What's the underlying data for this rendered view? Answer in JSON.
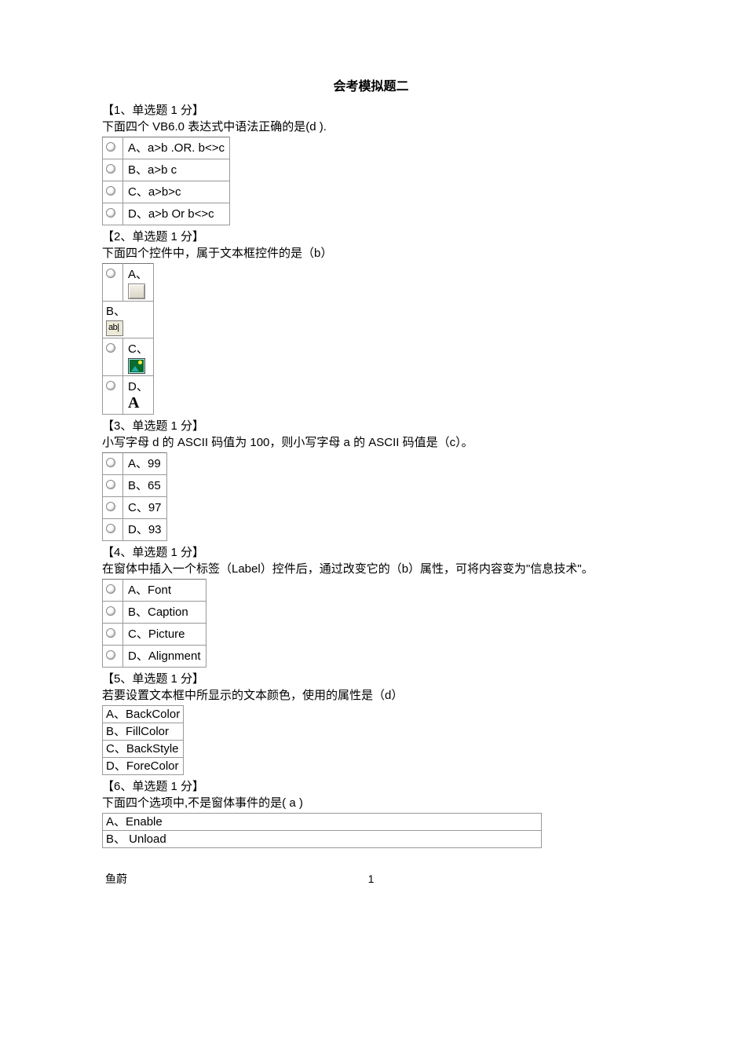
{
  "title": "会考模拟题二",
  "questions": [
    {
      "header": "【1、单选题 1 分】",
      "text": "下面四个 VB6.0 表达式中语法正确的是(d ).",
      "options": [
        {
          "label": "A、a>b .OR. b<>c",
          "radio": true
        },
        {
          "label": "B、a>b c",
          "radio": true
        },
        {
          "label": "C、a>b>c",
          "radio": true
        },
        {
          "label": "D、a>b Or b<>c",
          "radio": true
        }
      ]
    },
    {
      "header": "【2、单选题 1 分】",
      "text": "下面四个控件中，属于文本框控件的是（b）",
      "options": [
        {
          "label": "A、",
          "radio": true,
          "icon": "button"
        },
        {
          "label": "B、",
          "radio": false,
          "icon": "textbox",
          "noradio": true
        },
        {
          "label": "C、",
          "radio": true,
          "icon": "picturebox"
        },
        {
          "label": "D、",
          "radio": true,
          "icon": "label"
        }
      ]
    },
    {
      "header": "【3、单选题 1 分】",
      "text": "小写字母 d 的 ASCII 码值为 100，则小写字母 a 的 ASCII 码值是（c）。",
      "options": [
        {
          "label": "A、99",
          "radio": true
        },
        {
          "label": "B、65",
          "radio": true
        },
        {
          "label": "C、97",
          "radio": true
        },
        {
          "label": "D、93",
          "radio": true
        }
      ]
    },
    {
      "header": "【4、单选题 1 分】",
      "text": "在窗体中插入一个标签（Label）控件后，通过改变它的（b）属性，可将内容变为\"信息技术\"。",
      "options": [
        {
          "label": "A、Font",
          "radio": true
        },
        {
          "label": "B、Caption",
          "radio": true
        },
        {
          "label": "C、Picture",
          "radio": true
        },
        {
          "label": "D、Alignment",
          "radio": true
        }
      ]
    },
    {
      "header": "【5、单选题 1 分】",
      "text": "若要设置文本框中所显示的文本颜色，使用的属性是（d）",
      "options": [
        {
          "label": "A、BackColor",
          "radio": false
        },
        {
          "label": "B、FillColor",
          "radio": false
        },
        {
          "label": "C、BackStyle",
          "radio": false
        },
        {
          "label": "D、ForeColor",
          "radio": false
        }
      ]
    },
    {
      "header": "【6、单选题 1 分】",
      "text": "下面四个选项中,不是窗体事件的是(    a    )",
      "options": [
        {
          "label": "A、Enable",
          "radio": false,
          "wide": true
        },
        {
          "label": "B、 Unload",
          "radio": false,
          "wide": true
        }
      ]
    }
  ],
  "footer": {
    "author": "鱼蔚",
    "page": "1"
  }
}
